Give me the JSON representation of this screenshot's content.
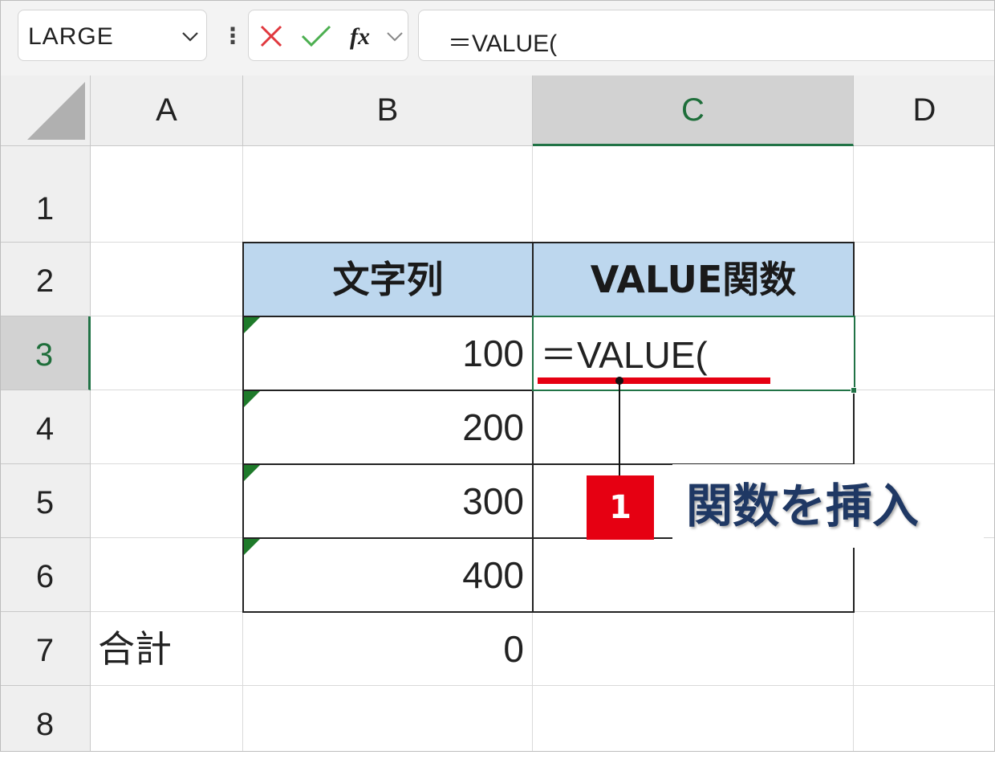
{
  "formula_bar": {
    "name_box": "LARGE",
    "formula": "＝VALUE("
  },
  "columns": [
    "A",
    "B",
    "C",
    "D"
  ],
  "rows": [
    "1",
    "2",
    "3",
    "4",
    "5",
    "6",
    "7",
    "8"
  ],
  "table": {
    "header_b": "文字列",
    "header_c": "VALUE関数",
    "b_values": [
      "100",
      "200",
      "300",
      "400"
    ]
  },
  "cells": {
    "a7": "合計",
    "b7": "0",
    "c3": "＝VALUE("
  },
  "callout": {
    "step": "1",
    "text": "関数を挿入"
  },
  "colors": {
    "header_fill": "#bdd7ee",
    "accent_red": "#e60012",
    "callout_text": "#1f3864",
    "excel_green": "#217346"
  }
}
